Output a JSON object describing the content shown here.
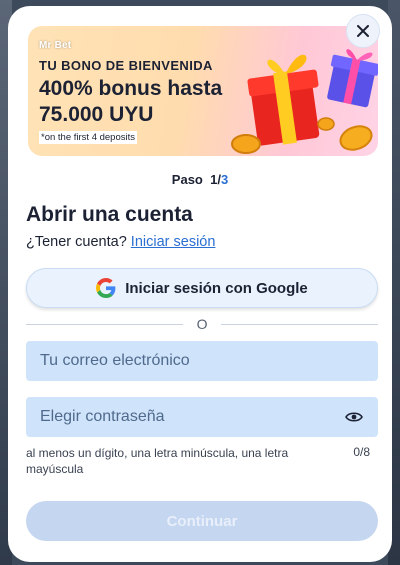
{
  "banner": {
    "brand": "Mr Bet",
    "kicker": "TU BONO DE BIENVENIDA",
    "title": "400% bonus hasta 75.000 UYU",
    "note": "*on the first 4 deposits"
  },
  "step": {
    "label": "Paso",
    "current": "1",
    "separator": "/",
    "total": "3"
  },
  "form": {
    "title": "Abrir una cuenta",
    "has_account_text": "¿Tener cuenta?",
    "login_link": "Iniciar sesión",
    "google_label": "Iniciar sesión con Google",
    "divider": "O",
    "email_placeholder": "Tu correo electrónico",
    "email_value": "",
    "password_placeholder": "Elegir contraseña",
    "password_value": "",
    "password_hint": "al menos un dígito, una letra minúscula, una letra mayúscula",
    "password_counter": "0/8",
    "continue_label": "Continuar"
  },
  "colors": {
    "accent": "#2a6fd1",
    "input_bg": "#cfe3fb",
    "button_disabled": "#c5d6f0",
    "text": "#1c2233"
  },
  "icons": [
    "close-icon",
    "google-icon",
    "eye-icon",
    "gift-icon",
    "coin-icon"
  ]
}
